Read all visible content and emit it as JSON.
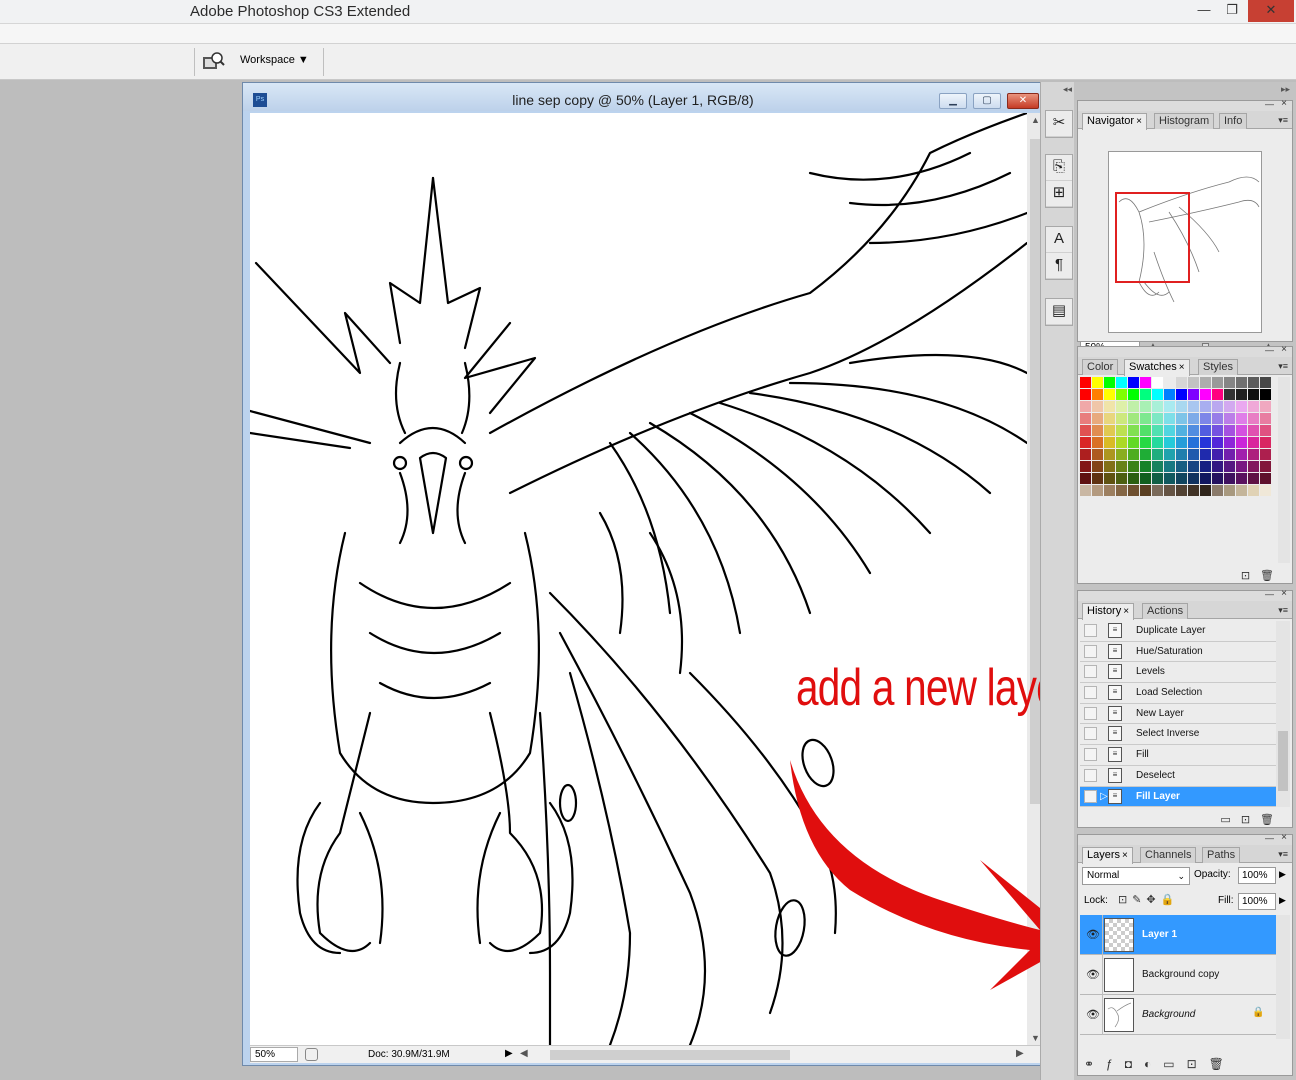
{
  "window": {
    "title": "Adobe Photoshop CS3 Extended",
    "minimize": "—",
    "restore": "❐",
    "close": "✕"
  },
  "options_bar": {
    "workspace_label": "Workspace ▼",
    "bridge_icon": "bridge-icon"
  },
  "document": {
    "title": "line sep copy @ 50% (Layer 1, RGB/8)",
    "ps_icon": "Ps",
    "status_zoom": "50%",
    "status_doc": "Doc: 30.9M/31.9M",
    "status_play": "▶",
    "scroll_left": "◀",
    "scroll_right": "▶",
    "scroll_up": "▲",
    "scroll_down": "▼"
  },
  "dock": {
    "collapse": "◂◂",
    "tools": [
      "✂",
      "⎘",
      "⊞",
      "A",
      "¶",
      "▤"
    ]
  },
  "panels": {
    "collapse": "▸▸",
    "navigator": {
      "tabs": [
        "Navigator",
        "Histogram",
        "Info"
      ],
      "active_tab": "Navigator",
      "zoom": "50%"
    },
    "swatches": {
      "tabs": [
        "Color",
        "Swatches",
        "Styles"
      ],
      "active_tab": "Swatches"
    },
    "history": {
      "tabs": [
        "History",
        "Actions"
      ],
      "active_tab": "History",
      "items": [
        "Duplicate Layer",
        "Hue/Saturation",
        "Levels",
        "Load Selection",
        "New Layer",
        "Select Inverse",
        "Fill",
        "Deselect",
        "Fill Layer"
      ],
      "selected": "Fill Layer"
    },
    "layers": {
      "tabs": [
        "Layers",
        "Channels",
        "Paths"
      ],
      "active_tab": "Layers",
      "blend_mode": "Normal",
      "opacity_label": "Opacity:",
      "opacity": "100%",
      "lock_label": "Lock:",
      "fill_label": "Fill:",
      "fill": "100%",
      "items": [
        {
          "name": "Layer 1",
          "selected": true
        },
        {
          "name": "Background copy",
          "selected": false
        },
        {
          "name": "Background",
          "selected": false,
          "locked": true
        }
      ]
    }
  },
  "annotation": {
    "text": "add a new layer",
    "color": "#e00e0e"
  },
  "colors": {
    "selection": "#3399ff",
    "panel_bg": "#ececec",
    "workspace_bg": "#bdbdbd"
  }
}
